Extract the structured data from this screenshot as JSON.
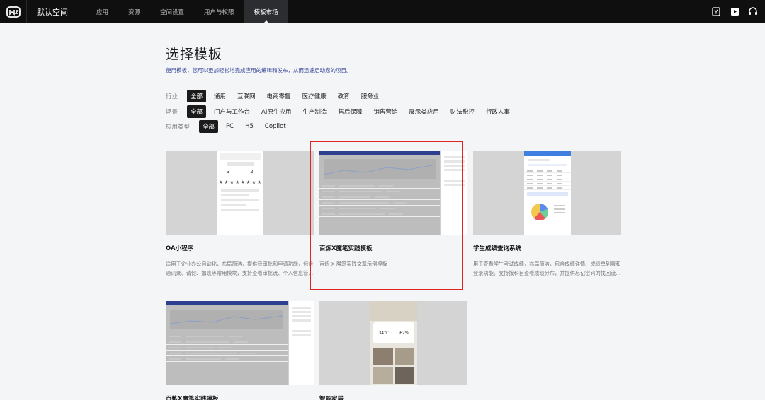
{
  "nav": {
    "space_name": "默认空间",
    "tabs": [
      "应用",
      "资源",
      "空间设置",
      "用户与权限",
      "模板市场"
    ],
    "active_tab": "模板市场"
  },
  "header": {
    "title": "选择模板",
    "description": "使用模板，您可以更加轻松地完成应用的编辑和发布，从而迅速启动您的项目。"
  },
  "filters": {
    "industry": {
      "label": "行业",
      "options": [
        "全部",
        "通用",
        "互联网",
        "电商零售",
        "医疗健康",
        "教育",
        "服务业"
      ]
    },
    "scene": {
      "label": "场景",
      "options": [
        "全部",
        "门户与工作台",
        "AI原生应用",
        "生产制造",
        "售后保障",
        "销售营销",
        "展示类应用",
        "财法税控",
        "行政人事"
      ]
    },
    "app_type": {
      "label": "应用类型",
      "options": [
        "全部",
        "PC",
        "H5",
        "Copilot"
      ]
    }
  },
  "cards": [
    {
      "title": "OA小程序",
      "description": "适用于企业办公自动化，布局简洁，提供待审批和申请功能，包含通讯录、请假、加班等常用模块，支持查看审批流、个人信息管..."
    },
    {
      "title": "百炼X魔笔实践模板",
      "description": "百炼 X 魔笔实践文章示例模板"
    },
    {
      "title": "学生成绩查询系统",
      "description": "用于查看学生考试成绩，布局简洁，包含成绩详情、成绩单列表和登录功能。支持按科目查看成绩分布，并提供忘记密码的找回流..."
    },
    {
      "title": "百炼X魔笔实践模板",
      "description": ""
    },
    {
      "title": "智能家居",
      "description": ""
    }
  ],
  "thumb_text": {
    "oa_stat_1": "3",
    "oa_stat_2": "2",
    "home_temp": "34°C",
    "home_humidity": "62%"
  }
}
